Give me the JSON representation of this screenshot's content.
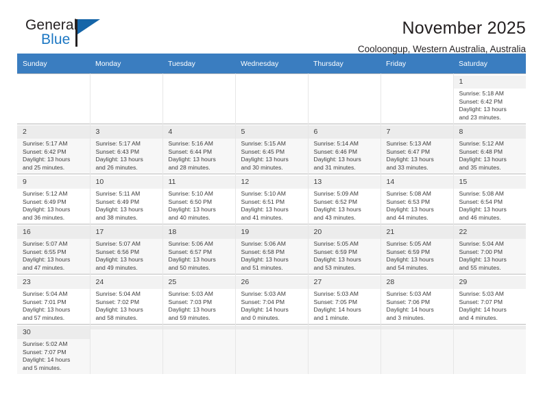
{
  "brand": {
    "name_top": "General",
    "name_bottom": "Blue",
    "accent_color": "#1c77c3",
    "triangle_color": "#1565a8"
  },
  "header": {
    "title": "November 2025",
    "location": "Cooloongup, Western Australia, Australia",
    "header_bg_color": "#3a7dc0"
  },
  "weekday_headers": [
    "Sunday",
    "Monday",
    "Tuesday",
    "Wednesday",
    "Thursday",
    "Friday",
    "Saturday"
  ],
  "weeks": [
    [
      {
        "day": "",
        "sunrise": "",
        "sunset": "",
        "daylight1": "",
        "daylight2": ""
      },
      {
        "day": "",
        "sunrise": "",
        "sunset": "",
        "daylight1": "",
        "daylight2": ""
      },
      {
        "day": "",
        "sunrise": "",
        "sunset": "",
        "daylight1": "",
        "daylight2": ""
      },
      {
        "day": "",
        "sunrise": "",
        "sunset": "",
        "daylight1": "",
        "daylight2": ""
      },
      {
        "day": "",
        "sunrise": "",
        "sunset": "",
        "daylight1": "",
        "daylight2": ""
      },
      {
        "day": "",
        "sunrise": "",
        "sunset": "",
        "daylight1": "",
        "daylight2": ""
      },
      {
        "day": "1",
        "sunrise": "Sunrise: 5:18 AM",
        "sunset": "Sunset: 6:42 PM",
        "daylight1": "Daylight: 13 hours",
        "daylight2": "and 23 minutes."
      }
    ],
    [
      {
        "day": "2",
        "sunrise": "Sunrise: 5:17 AM",
        "sunset": "Sunset: 6:42 PM",
        "daylight1": "Daylight: 13 hours",
        "daylight2": "and 25 minutes."
      },
      {
        "day": "3",
        "sunrise": "Sunrise: 5:17 AM",
        "sunset": "Sunset: 6:43 PM",
        "daylight1": "Daylight: 13 hours",
        "daylight2": "and 26 minutes."
      },
      {
        "day": "4",
        "sunrise": "Sunrise: 5:16 AM",
        "sunset": "Sunset: 6:44 PM",
        "daylight1": "Daylight: 13 hours",
        "daylight2": "and 28 minutes."
      },
      {
        "day": "5",
        "sunrise": "Sunrise: 5:15 AM",
        "sunset": "Sunset: 6:45 PM",
        "daylight1": "Daylight: 13 hours",
        "daylight2": "and 30 minutes."
      },
      {
        "day": "6",
        "sunrise": "Sunrise: 5:14 AM",
        "sunset": "Sunset: 6:46 PM",
        "daylight1": "Daylight: 13 hours",
        "daylight2": "and 31 minutes."
      },
      {
        "day": "7",
        "sunrise": "Sunrise: 5:13 AM",
        "sunset": "Sunset: 6:47 PM",
        "daylight1": "Daylight: 13 hours",
        "daylight2": "and 33 minutes."
      },
      {
        "day": "8",
        "sunrise": "Sunrise: 5:12 AM",
        "sunset": "Sunset: 6:48 PM",
        "daylight1": "Daylight: 13 hours",
        "daylight2": "and 35 minutes."
      }
    ],
    [
      {
        "day": "9",
        "sunrise": "Sunrise: 5:12 AM",
        "sunset": "Sunset: 6:49 PM",
        "daylight1": "Daylight: 13 hours",
        "daylight2": "and 36 minutes."
      },
      {
        "day": "10",
        "sunrise": "Sunrise: 5:11 AM",
        "sunset": "Sunset: 6:49 PM",
        "daylight1": "Daylight: 13 hours",
        "daylight2": "and 38 minutes."
      },
      {
        "day": "11",
        "sunrise": "Sunrise: 5:10 AM",
        "sunset": "Sunset: 6:50 PM",
        "daylight1": "Daylight: 13 hours",
        "daylight2": "and 40 minutes."
      },
      {
        "day": "12",
        "sunrise": "Sunrise: 5:10 AM",
        "sunset": "Sunset: 6:51 PM",
        "daylight1": "Daylight: 13 hours",
        "daylight2": "and 41 minutes."
      },
      {
        "day": "13",
        "sunrise": "Sunrise: 5:09 AM",
        "sunset": "Sunset: 6:52 PM",
        "daylight1": "Daylight: 13 hours",
        "daylight2": "and 43 minutes."
      },
      {
        "day": "14",
        "sunrise": "Sunrise: 5:08 AM",
        "sunset": "Sunset: 6:53 PM",
        "daylight1": "Daylight: 13 hours",
        "daylight2": "and 44 minutes."
      },
      {
        "day": "15",
        "sunrise": "Sunrise: 5:08 AM",
        "sunset": "Sunset: 6:54 PM",
        "daylight1": "Daylight: 13 hours",
        "daylight2": "and 46 minutes."
      }
    ],
    [
      {
        "day": "16",
        "sunrise": "Sunrise: 5:07 AM",
        "sunset": "Sunset: 6:55 PM",
        "daylight1": "Daylight: 13 hours",
        "daylight2": "and 47 minutes."
      },
      {
        "day": "17",
        "sunrise": "Sunrise: 5:07 AM",
        "sunset": "Sunset: 6:56 PM",
        "daylight1": "Daylight: 13 hours",
        "daylight2": "and 49 minutes."
      },
      {
        "day": "18",
        "sunrise": "Sunrise: 5:06 AM",
        "sunset": "Sunset: 6:57 PM",
        "daylight1": "Daylight: 13 hours",
        "daylight2": "and 50 minutes."
      },
      {
        "day": "19",
        "sunrise": "Sunrise: 5:06 AM",
        "sunset": "Sunset: 6:58 PM",
        "daylight1": "Daylight: 13 hours",
        "daylight2": "and 51 minutes."
      },
      {
        "day": "20",
        "sunrise": "Sunrise: 5:05 AM",
        "sunset": "Sunset: 6:59 PM",
        "daylight1": "Daylight: 13 hours",
        "daylight2": "and 53 minutes."
      },
      {
        "day": "21",
        "sunrise": "Sunrise: 5:05 AM",
        "sunset": "Sunset: 6:59 PM",
        "daylight1": "Daylight: 13 hours",
        "daylight2": "and 54 minutes."
      },
      {
        "day": "22",
        "sunrise": "Sunrise: 5:04 AM",
        "sunset": "Sunset: 7:00 PM",
        "daylight1": "Daylight: 13 hours",
        "daylight2": "and 55 minutes."
      }
    ],
    [
      {
        "day": "23",
        "sunrise": "Sunrise: 5:04 AM",
        "sunset": "Sunset: 7:01 PM",
        "daylight1": "Daylight: 13 hours",
        "daylight2": "and 57 minutes."
      },
      {
        "day": "24",
        "sunrise": "Sunrise: 5:04 AM",
        "sunset": "Sunset: 7:02 PM",
        "daylight1": "Daylight: 13 hours",
        "daylight2": "and 58 minutes."
      },
      {
        "day": "25",
        "sunrise": "Sunrise: 5:03 AM",
        "sunset": "Sunset: 7:03 PM",
        "daylight1": "Daylight: 13 hours",
        "daylight2": "and 59 minutes."
      },
      {
        "day": "26",
        "sunrise": "Sunrise: 5:03 AM",
        "sunset": "Sunset: 7:04 PM",
        "daylight1": "Daylight: 14 hours",
        "daylight2": "and 0 minutes."
      },
      {
        "day": "27",
        "sunrise": "Sunrise: 5:03 AM",
        "sunset": "Sunset: 7:05 PM",
        "daylight1": "Daylight: 14 hours",
        "daylight2": "and 1 minute."
      },
      {
        "day": "28",
        "sunrise": "Sunrise: 5:03 AM",
        "sunset": "Sunset: 7:06 PM",
        "daylight1": "Daylight: 14 hours",
        "daylight2": "and 3 minutes."
      },
      {
        "day": "29",
        "sunrise": "Sunrise: 5:03 AM",
        "sunset": "Sunset: 7:07 PM",
        "daylight1": "Daylight: 14 hours",
        "daylight2": "and 4 minutes."
      }
    ],
    [
      {
        "day": "30",
        "sunrise": "Sunrise: 5:02 AM",
        "sunset": "Sunset: 7:07 PM",
        "daylight1": "Daylight: 14 hours",
        "daylight2": "and 5 minutes."
      },
      {
        "day": "",
        "sunrise": "",
        "sunset": "",
        "daylight1": "",
        "daylight2": ""
      },
      {
        "day": "",
        "sunrise": "",
        "sunset": "",
        "daylight1": "",
        "daylight2": ""
      },
      {
        "day": "",
        "sunrise": "",
        "sunset": "",
        "daylight1": "",
        "daylight2": ""
      },
      {
        "day": "",
        "sunrise": "",
        "sunset": "",
        "daylight1": "",
        "daylight2": ""
      },
      {
        "day": "",
        "sunrise": "",
        "sunset": "",
        "daylight1": "",
        "daylight2": ""
      },
      {
        "day": "",
        "sunrise": "",
        "sunset": "",
        "daylight1": "",
        "daylight2": ""
      }
    ]
  ]
}
